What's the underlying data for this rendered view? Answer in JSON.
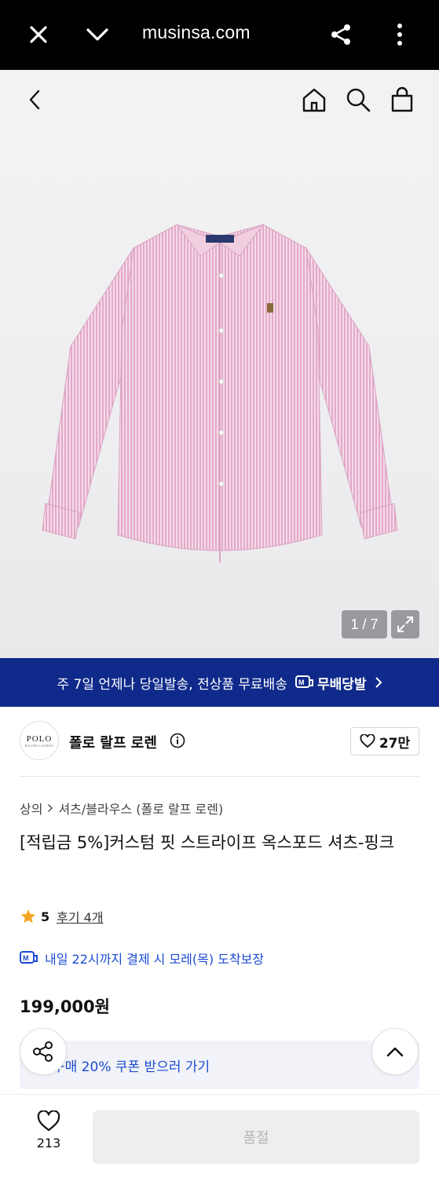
{
  "browser": {
    "url": "musinsa.com",
    "icons": [
      "close-icon",
      "chevron-down-icon",
      "share-icon",
      "more-vertical-icon"
    ]
  },
  "header": {
    "icons": [
      "back-icon",
      "home-icon",
      "search-icon",
      "cart-icon"
    ]
  },
  "gallery": {
    "counter": "1 / 7",
    "product_color": "#e7b9d3"
  },
  "banner": {
    "text": "주 7일 언제나 당일발송, 전상품 무료배송",
    "badge_text": "무배당발",
    "background": "#0f2a8a"
  },
  "brand": {
    "logo_text": "POLO",
    "logo_sub": "RALPH LAUREN",
    "name": "폴로 랄프 로렌",
    "likes": "27만"
  },
  "product": {
    "breadcrumb": [
      "상의",
      "셔츠/블라우스 (폴로 랄프 로렌)"
    ],
    "title": "[적립금 5%]커스텀 핏 스트라이프 옥스포드 셔츠-핑크",
    "rating": "5",
    "reviews": "후기 4개",
    "delivery": "내일 22시까지 결제 시 모레(목) 도착보장",
    "price": "199,000원",
    "coupon": "구매 20% 쿠폰 받으러 가기"
  },
  "bottom": {
    "like_count": "213",
    "cta": "품절"
  },
  "colors": {
    "accent_blue": "#1d4bd1",
    "star": "#f5a623"
  }
}
